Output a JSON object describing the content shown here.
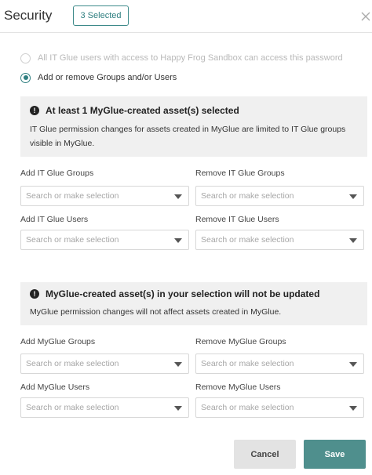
{
  "header": {
    "title": "Security",
    "selected_badge": "3 Selected"
  },
  "access": {
    "option_all": "All IT Glue users with access to Happy Frog Sandbox can access this password",
    "option_custom": "Add or remove Groups and/or Users",
    "selected": "custom"
  },
  "itglue_section": {
    "notice_title": "At least 1 MyGlue-created asset(s) selected",
    "notice_body": "IT Glue permission changes for assets created in MyGlue are limited to IT Glue groups visible in MyGlue.",
    "add_groups_label": "Add IT Glue Groups",
    "remove_groups_label": "Remove IT Glue Groups",
    "add_users_label": "Add IT Glue Users",
    "remove_users_label": "Remove IT Glue Users"
  },
  "myglue_section": {
    "notice_title": "MyGlue-created asset(s) in your selection will not be updated",
    "notice_body": "MyGlue permission changes will not affect assets created in MyGlue.",
    "add_groups_label": "Add MyGlue Groups",
    "remove_groups_label": "Remove MyGlue Groups",
    "add_users_label": "Add MyGlue Users",
    "remove_users_label": "Remove MyGlue Users"
  },
  "select_placeholder": "Search or make selection",
  "footer": {
    "cancel_label": "Cancel",
    "save_label": "Save"
  },
  "colors": {
    "accent": "#2f7f80",
    "save_button": "#4f8f8d",
    "notice_bg": "#f0f0f0"
  }
}
